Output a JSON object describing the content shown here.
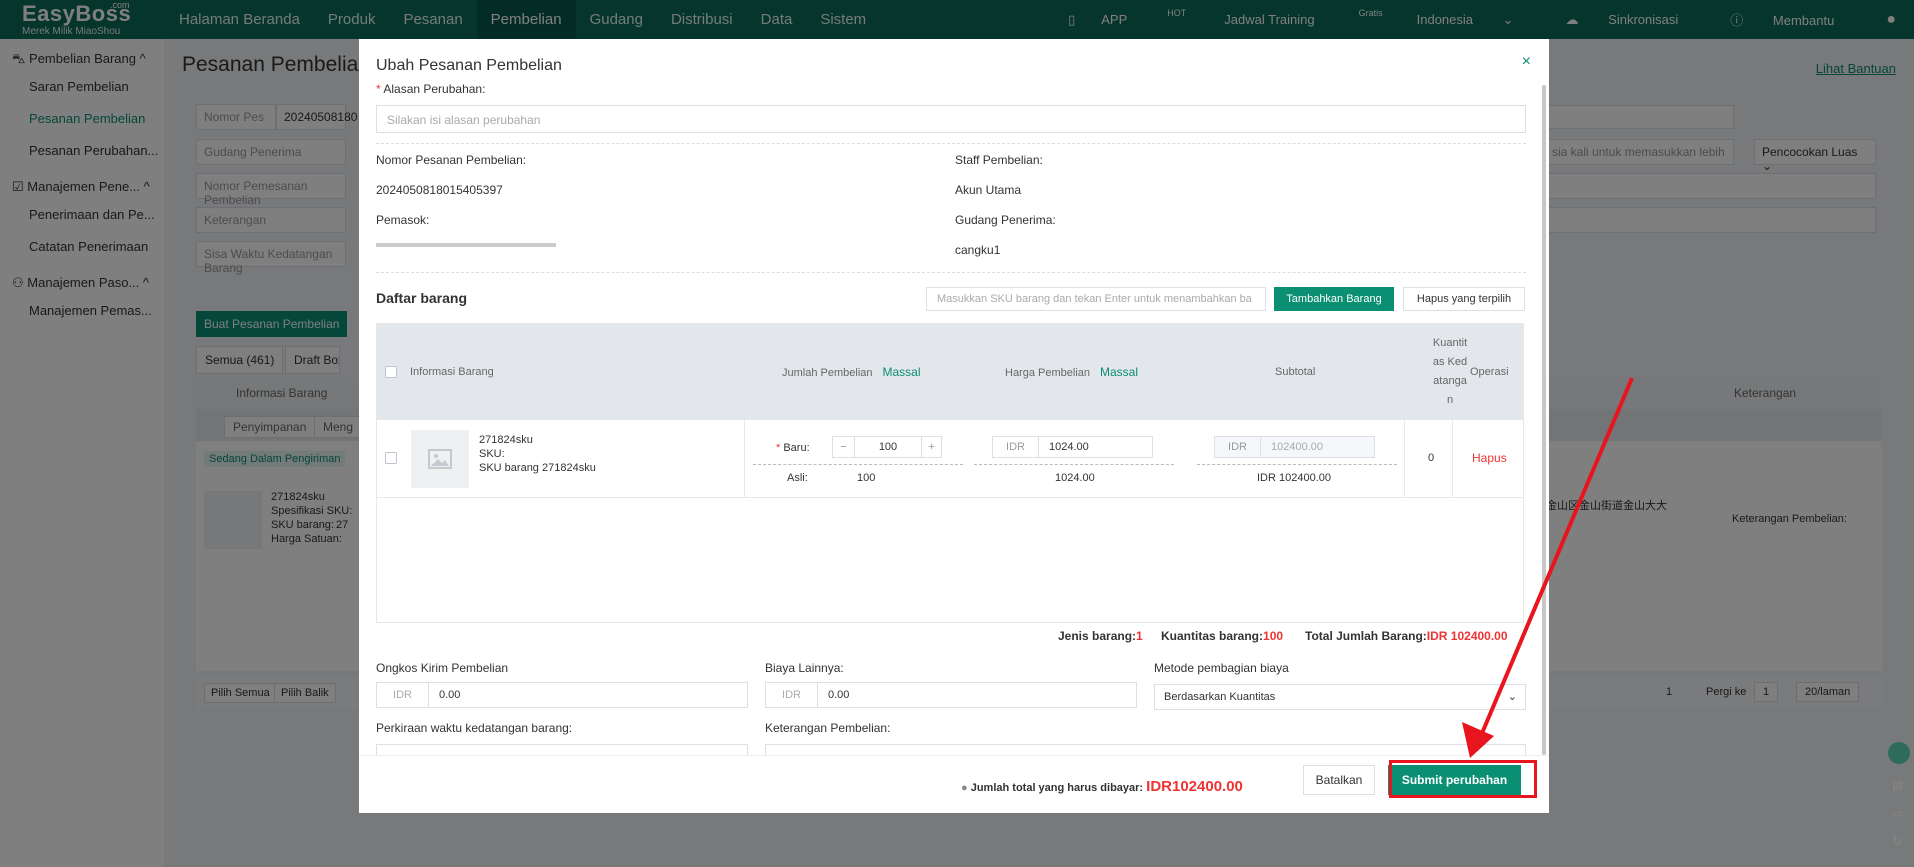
{
  "topnav": {
    "logo": "EasyBoss",
    "logo_com": ".com",
    "logo_sub": "Merek Milik MiaoShou",
    "items": [
      "Halaman Beranda",
      "Produk",
      "Pesanan",
      "Pembelian",
      "Gudang",
      "Distribusi",
      "Data",
      "Sistem"
    ],
    "right": {
      "app": "APP",
      "app_badge": "HOT",
      "training": "Jadwal Training",
      "training_badge": "Gratis",
      "language": "Indonesia",
      "sync": "Sinkronisasi",
      "help": "Membantu"
    }
  },
  "sidebar": {
    "group1": "Pembelian Barang",
    "items1": [
      "Saran Pembelian",
      "Pesanan Pembelian",
      "Pesanan Perubahan..."
    ],
    "group2": "Manajemen Pene...",
    "items2": [
      "Penerimaan dan Pe...",
      "Catatan Penerimaan"
    ],
    "group3": "Manajemen Paso...",
    "items3": [
      "Manajemen Pemas..."
    ]
  },
  "background": {
    "title": "Pesanan Pembelian",
    "help_link": "Lihat Bantuan",
    "filter_nomor": "Nomor Pes",
    "filter_nomor_value": "20240508180",
    "filter_gudang": "Gudang Penerima",
    "filter_nomor_pemesanan": "Nomor Pemesanan Pembelian",
    "filter_keterangan": "Keterangan",
    "filter_sisa": "Sisa Waktu Kedatangan Barang",
    "filter_hint": "sia kali untuk memasukkan lebih",
    "match_select": "Pencocokan Luas",
    "create_button": "Buat Pesanan Pembelian",
    "tab_all": "Semua (461)",
    "tab_draft": "Draft Box (1",
    "col_info": "Informasi Barang",
    "col_ket": "Keterangan",
    "btn_simpan": "Penyimpanan",
    "btn_meng": "Meng",
    "status": "Sedang Dalam Pengiriman",
    "row_sku": "271824sku",
    "row_spec": "Spesifikasi SKU:",
    "row_skubarang": "SKU barang:",
    "row_skubarang_val": "27",
    "row_harga": "Harga Satuan:",
    "row_address": "金山区金山街道金山大大",
    "row_ket": "Keterangan Pembelian:",
    "select_all": "Pilih Semua",
    "select_reverse": "Pilih Balik",
    "page": "1",
    "goto": "Pergi ke",
    "goto_value": "1",
    "per_page": "20/laman"
  },
  "modal": {
    "title": "Ubah Pesanan Pembelian",
    "reason_label": "Alasan Perubahan:",
    "reason_placeholder": "Silakan isi alasan perubahan",
    "order_no_label": "Nomor Pesanan Pembelian:",
    "order_no": "2024050818015405397",
    "staff_label": "Staff Pembelian:",
    "staff": "Akun Utama",
    "supplier_label": "Pemasok:",
    "warehouse_label": "Gudang Penerima:",
    "warehouse": "cangku1",
    "list_title": "Daftar barang",
    "sku_placeholder": "Masukkan SKU barang dan tekan Enter untuk menambahkan ba",
    "add_button": "Tambahkan Barang",
    "delete_selected": "Hapus yang terpilih",
    "table": {
      "h_info": "Informasi Barang",
      "h_qty": "Jumlah Pembelian",
      "h_price": "Harga Pembelian",
      "h_mass": "Massal",
      "h_subtotal": "Subtotal",
      "h_arrived": "Kuantitas Kedatangan",
      "h_op": "Operasi",
      "row": {
        "name": "271824sku",
        "sku": "SKU:",
        "sku_barang": "SKU barang 271824sku",
        "new_label": "Baru:",
        "orig_label": "Asli:",
        "qty_new": "100",
        "qty_orig": "100",
        "currency": "IDR",
        "price_new": "1024.00",
        "price_orig": "1024.00",
        "subtotal_new": "102400.00",
        "subtotal_orig": "IDR 102400.00",
        "arrived": "0",
        "delete": "Hapus",
        "minus": "−",
        "plus": "+"
      }
    },
    "summary": {
      "jenis_label": "Jenis barang:",
      "jenis": "1",
      "qty_label": "Kuantitas barang:",
      "qty": "100",
      "total_label": "Total Jumlah Barang:",
      "total": "IDR 102400.00"
    },
    "shipping_label": "Ongkos Kirim Pembelian",
    "shipping_currency": "IDR",
    "shipping_value": "0.00",
    "other_label": "Biaya Lainnya:",
    "other_currency": "IDR",
    "other_value": "0.00",
    "method_label": "Metode pembagian biaya",
    "method_value": "Berdasarkan Kuantitas",
    "eta_label": "Perkiraan waktu kedatangan barang:",
    "note_label": "Keterangan Pembelian:",
    "footer": {
      "total_label": "Jumlah total yang harus dibayar:",
      "total_amount": "IDR102400.00",
      "cancel": "Batalkan",
      "submit": "Submit perubahan"
    }
  },
  "colors": {
    "nav": "#0a6b57",
    "accent": "#0a8f73",
    "danger": "#e33",
    "highlight": "#e8141e"
  }
}
